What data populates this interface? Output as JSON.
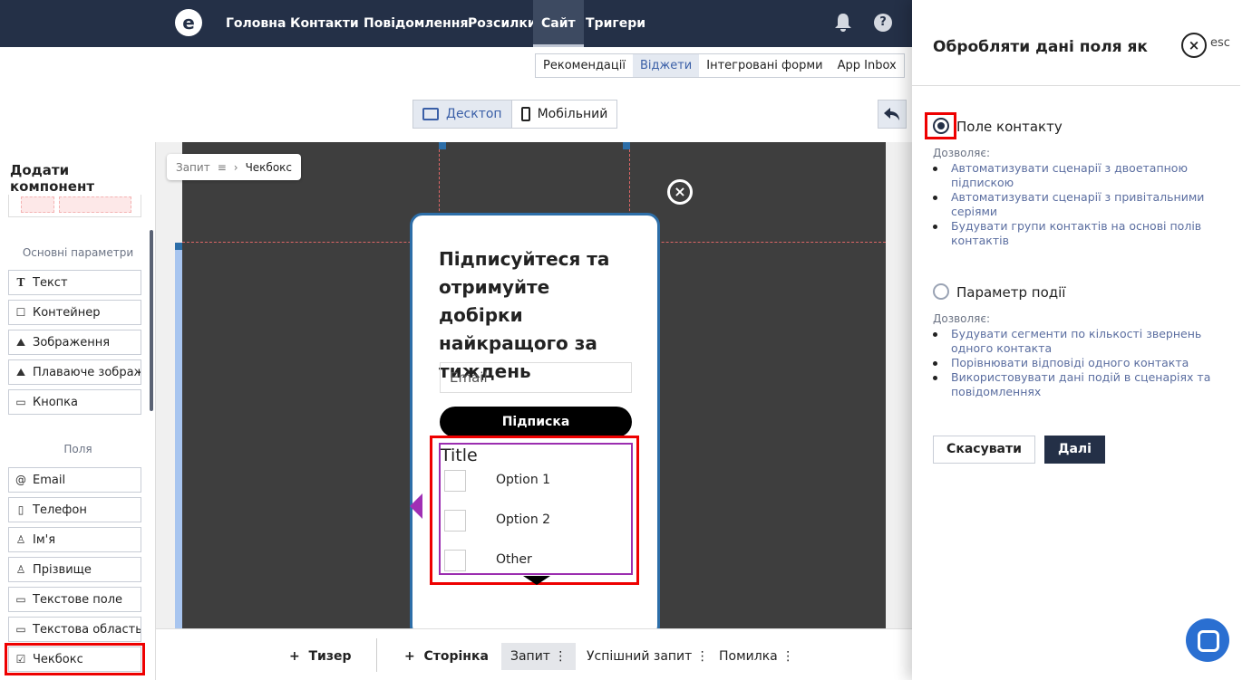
{
  "nav": {
    "logo": "e",
    "items": [
      "Головна",
      "Контакти",
      "Повідомлення",
      "Розсилки",
      "Сайт",
      "Тригери"
    ],
    "active": "Сайт"
  },
  "subtabs": [
    "Рекомендації",
    "Віджети",
    "Інтегровані форми",
    "App Inbox"
  ],
  "device": {
    "desktop": "Десктоп",
    "mobile": "Мобільний"
  },
  "sidebar": {
    "title": "Додати компонент",
    "section_main": "Основні параметри",
    "main_items": [
      "Текст",
      "Контейнер",
      "Зображення",
      "Плаваюче зображення",
      "Кнопка"
    ],
    "section_fields": "Поля",
    "field_items": [
      "Email",
      "Телефон",
      "Ім'я",
      "Прізвище",
      "Текстове поле",
      "Текстова область",
      "Чекбокс"
    ]
  },
  "breadcrumb": {
    "parent": "Запит",
    "current": "Чекбокс"
  },
  "popup": {
    "title": "Підписуйтеся та отримуйте добірки найкращого за тиждень",
    "email_placeholder": "Email",
    "subscribe": "Підписка",
    "checkbox_title": "Title",
    "options": [
      "Option 1",
      "Option 2",
      "Other"
    ]
  },
  "bottombar": {
    "teaser": "Тизер",
    "page": "Сторінка",
    "tabs": [
      "Запит",
      "Успішний запит",
      "Помилка"
    ]
  },
  "panel": {
    "title": "Обробляти дані поля як",
    "esc": "esc",
    "option1": {
      "label": "Поле контакту",
      "allows": "Дозволяє:",
      "items": [
        "Автоматизувати сценарії з двоетапною підпискою",
        "Автоматизувати сценарії з привітальними серіями",
        "Будувати групи контактів на основі полів контактів"
      ]
    },
    "option2": {
      "label": "Параметр події",
      "allows": "Дозволяє:",
      "items": [
        "Будувати сегменти по кількості звернень одного контакта",
        "Порівнювати відповіді одного контакта",
        "Використовувати дані подій в сценаріях та повідомленнях"
      ]
    },
    "cancel": "Скасувати",
    "next": "Далі"
  },
  "colors": {
    "nav_bg": "#243047",
    "accent": "#2d6ea8",
    "highlight": "#ee0000",
    "purple": "#a02fb5"
  }
}
